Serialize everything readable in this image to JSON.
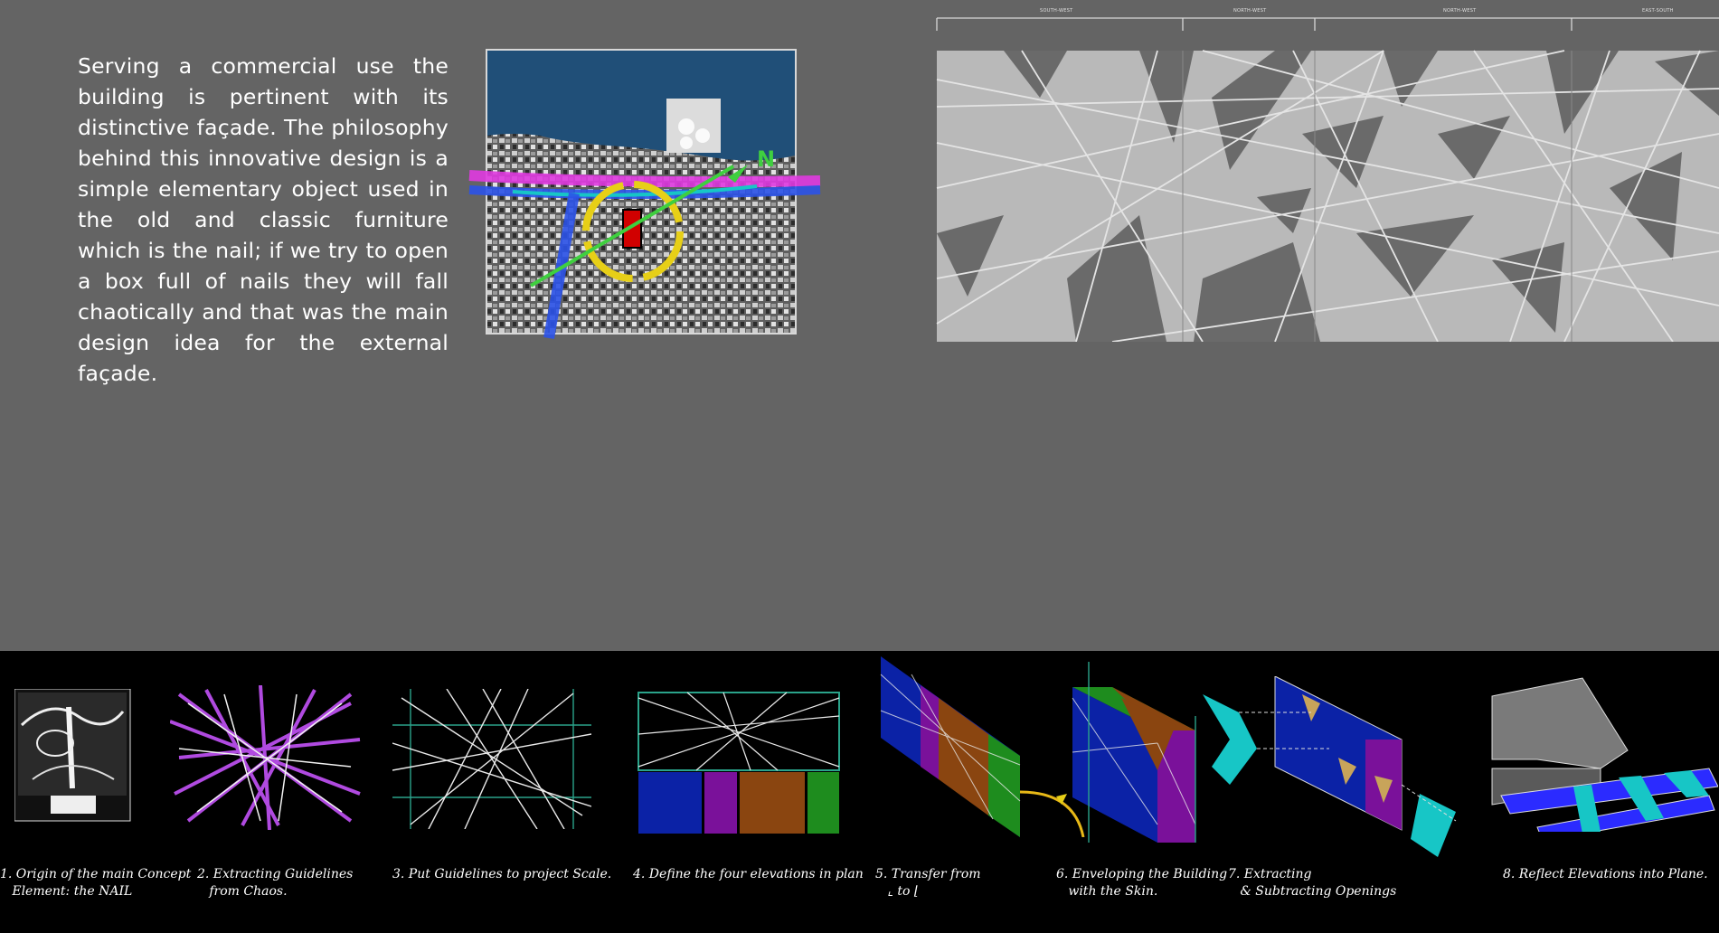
{
  "intro": {
    "text": "Serving a commercial use the building is pertinent with its distinctive façade. The philosophy behind this innovative design is a simple elementary object used in the old and classic furniture which is the nail; if we try to open a box full of nails they will fall chaotically and that was the main design idea for the external façade."
  },
  "site_map": {
    "north_label": "N"
  },
  "facade": {
    "labels": [
      "SOUTH-WEST",
      "NORTH-WEST",
      "NORTH-WEST",
      "EAST-SOUTH"
    ]
  },
  "steps": [
    {
      "caption": "1. Origin of the main Concept\n   Element: the NAIL"
    },
    {
      "caption": "2. Extracting Guidelines\n   from Chaos."
    },
    {
      "caption": "3. Put Guidelines to project Scale."
    },
    {
      "caption": "4. Define the four elevations in plan"
    },
    {
      "caption": "5. Transfer from\n   ⌞ to ⌊"
    },
    {
      "caption": "6. Enveloping the Building\n   with the Skin."
    },
    {
      "caption": "7. Extracting\n   & Subtracting Openings"
    },
    {
      "caption": "8. Reflect Elevations into Plane."
    }
  ],
  "colors": {
    "background": "#646464",
    "strip": "#000000",
    "blue": "#0b22a6",
    "purple": "#7a119a",
    "brown": "#8a4510",
    "green": "#1e8c1e",
    "cyan": "#17c6c6",
    "magenta": "#e03ae0",
    "route_blue": "#2b52e8",
    "ring_yellow": "#e7cf17",
    "site_red": "#d10000"
  }
}
